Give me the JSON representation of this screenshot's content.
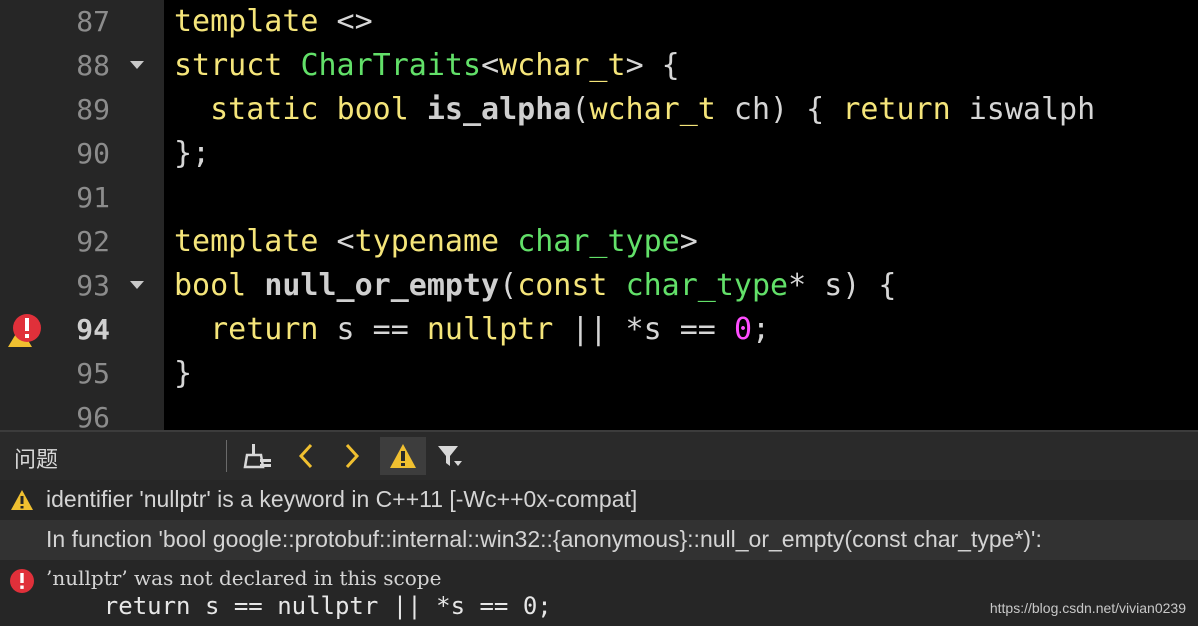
{
  "editor": {
    "lines": [
      {
        "number": "87",
        "tokens": [
          {
            "t": "template",
            "c": "kw"
          },
          {
            "t": " <>",
            "c": "pl"
          }
        ],
        "fold": false
      },
      {
        "number": "88",
        "tokens": [
          {
            "t": "struct",
            "c": "kw"
          },
          {
            "t": " ",
            "c": "pl"
          },
          {
            "t": "CharTraits",
            "c": "ty"
          },
          {
            "t": "<",
            "c": "pl"
          },
          {
            "t": "wchar_t",
            "c": "kw"
          },
          {
            "t": "> {",
            "c": "pl"
          }
        ],
        "fold": true
      },
      {
        "number": "89",
        "tokens": [
          {
            "t": "  ",
            "c": "pl"
          },
          {
            "t": "static",
            "c": "kw"
          },
          {
            "t": " ",
            "c": "pl"
          },
          {
            "t": "bool",
            "c": "kw"
          },
          {
            "t": " ",
            "c": "pl"
          },
          {
            "t": "is_alpha",
            "c": "fn"
          },
          {
            "t": "(",
            "c": "pl"
          },
          {
            "t": "wchar_t",
            "c": "kw"
          },
          {
            "t": " ch) { ",
            "c": "pl"
          },
          {
            "t": "return",
            "c": "kw"
          },
          {
            "t": " iswalph",
            "c": "pl"
          }
        ],
        "fold": false
      },
      {
        "number": "90",
        "tokens": [
          {
            "t": "};",
            "c": "pl"
          }
        ],
        "fold": false
      },
      {
        "number": "91",
        "tokens": [],
        "fold": false
      },
      {
        "number": "92",
        "tokens": [
          {
            "t": "template",
            "c": "kw"
          },
          {
            "t": " <",
            "c": "pl"
          },
          {
            "t": "typename",
            "c": "kw"
          },
          {
            "t": " ",
            "c": "pl"
          },
          {
            "t": "char_type",
            "c": "ty"
          },
          {
            "t": ">",
            "c": "pl"
          }
        ],
        "fold": false
      },
      {
        "number": "93",
        "tokens": [
          {
            "t": "bool",
            "c": "kw"
          },
          {
            "t": " ",
            "c": "pl"
          },
          {
            "t": "null_or_empty",
            "c": "fn"
          },
          {
            "t": "(",
            "c": "pl"
          },
          {
            "t": "const",
            "c": "kw"
          },
          {
            "t": " ",
            "c": "pl"
          },
          {
            "t": "char_type",
            "c": "ty"
          },
          {
            "t": "* s) {",
            "c": "pl"
          }
        ],
        "fold": true
      },
      {
        "number": "94",
        "tokens": [
          {
            "t": "  ",
            "c": "pl"
          },
          {
            "t": "return",
            "c": "kw"
          },
          {
            "t": " s == ",
            "c": "pl"
          },
          {
            "t": "nullptr",
            "c": "kw"
          },
          {
            "t": " || *s == ",
            "c": "pl"
          },
          {
            "t": "0",
            "c": "num"
          },
          {
            "t": ";",
            "c": "pl"
          }
        ],
        "fold": false,
        "active": true,
        "error": true
      },
      {
        "number": "95",
        "tokens": [
          {
            "t": "}",
            "c": "pl"
          }
        ],
        "fold": false
      },
      {
        "number": "96",
        "tokens": [],
        "fold": false
      }
    ]
  },
  "problems": {
    "title": "问题",
    "issues": {
      "warning_text": "identifier 'nullptr' is a keyword in C++11 [-Wc++0x-compat]",
      "context_text": "In function 'bool google::protobuf::internal::win32::{anonymous}::null_or_empty(const char_type*)':",
      "error_text": "’nullptr’ was not declared in this scope",
      "error_code": "    return s == nullptr || *s == 0;"
    }
  },
  "watermark": "https://blog.csdn.net/vivian0239",
  "colors": {
    "keyword": "#f5e57a",
    "type": "#62e069",
    "number": "#ff4dff",
    "warning": "#f0c030",
    "error": "#e0303a"
  }
}
